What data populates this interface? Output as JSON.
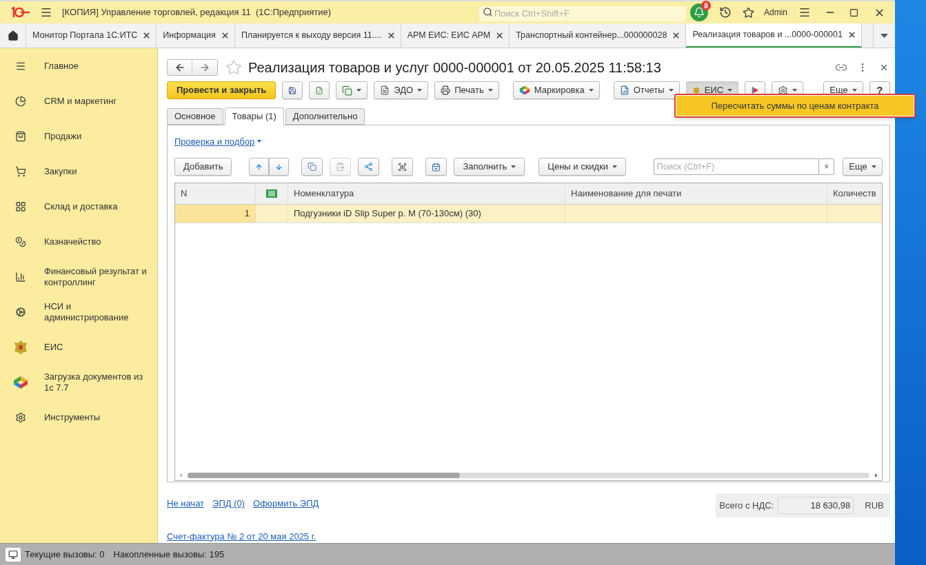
{
  "window": {
    "title": "[КОПИЯ] Управление торговлей, редакция 11  (1С:Предприятие)",
    "search_placeholder": "Поиск Ctrl+Shift+F",
    "notifications": "8",
    "user": "Admin"
  },
  "app_tabs": [
    {
      "label": "Монитор Портала 1С:ИТС",
      "selected": false
    },
    {
      "label": "Информация",
      "selected": false
    },
    {
      "label": "Планируется к выходу версия 11....",
      "selected": false
    },
    {
      "label": "АРМ ЕИС: ЕИС АРМ",
      "selected": false
    },
    {
      "label": "Транспортный контейнер...000000028",
      "selected": false
    },
    {
      "label": "Реализация товаров и ...0000-000001",
      "selected": true
    }
  ],
  "sidebar": {
    "items": [
      {
        "label": "Главное",
        "kind": "menu"
      },
      {
        "label": "CRM и маркетинг",
        "kind": "pie"
      },
      {
        "label": "Продажи",
        "kind": "bag"
      },
      {
        "label": "Закупки",
        "kind": "cart"
      },
      {
        "label": "Склад и доставка",
        "kind": "grid"
      },
      {
        "label": "Казначейство",
        "kind": "coins"
      },
      {
        "label": "Финансовый результат и контроллинг",
        "kind": "bars"
      },
      {
        "label": "НСИ и администрирование",
        "kind": "gear"
      },
      {
        "label": "ЕИС",
        "kind": "emblem"
      },
      {
        "label": "Загрузка документов из 1с 7.7",
        "kind": "logo"
      },
      {
        "label": "Инструменты",
        "kind": "tools"
      }
    ]
  },
  "form": {
    "title": "Реализация товаров и услуг 0000-000001 от 20.05.2025 11:58:13",
    "toolbar": {
      "post_and_close": "Провести и закрыть",
      "edo": "ЭДО",
      "print": "Печать",
      "marking": "Маркировка",
      "reports": "Отчеты",
      "eis": {
        "label": "ЕИС",
        "expanded": true
      },
      "more": "Еще",
      "help": "?"
    },
    "eis_menu": {
      "items": [
        {
          "label": "Пересчитать суммы по ценам контракта",
          "selected": true
        }
      ]
    },
    "tabs": [
      {
        "label": "Основное",
        "selected": false
      },
      {
        "label": "Товары (1)",
        "selected": true
      },
      {
        "label": "Дополнительно",
        "selected": false
      }
    ],
    "goods": {
      "check_link": "Проверка и подбор",
      "add": "Добавить",
      "fill": "Заполнить",
      "prices": "Цены и скидки",
      "search_placeholder": "Поиск (Ctrl+F)",
      "clear": "×",
      "more": "Еще",
      "columns": [
        "N",
        "Номенклатура",
        "Наименование для печати",
        "Количеств"
      ],
      "rows": [
        {
          "n": "1",
          "nomenclature": "Подгузники iD Slip Super р. М (70-130см) (30)",
          "selected": true
        }
      ]
    },
    "footer": {
      "links": [
        "Не начат",
        "ЭПД (0)",
        "Оформить ЭПД"
      ],
      "total_label": "Всего с НДС:",
      "total": "18 630,98",
      "currency": "RUB",
      "invoice_link": "Счет-фактура № 2 от 20 мая 2025 г."
    }
  },
  "status_bar": {
    "current_calls": "Текущие вызовы: 0",
    "accumulated_calls": "Накопленные вызовы: 195"
  }
}
